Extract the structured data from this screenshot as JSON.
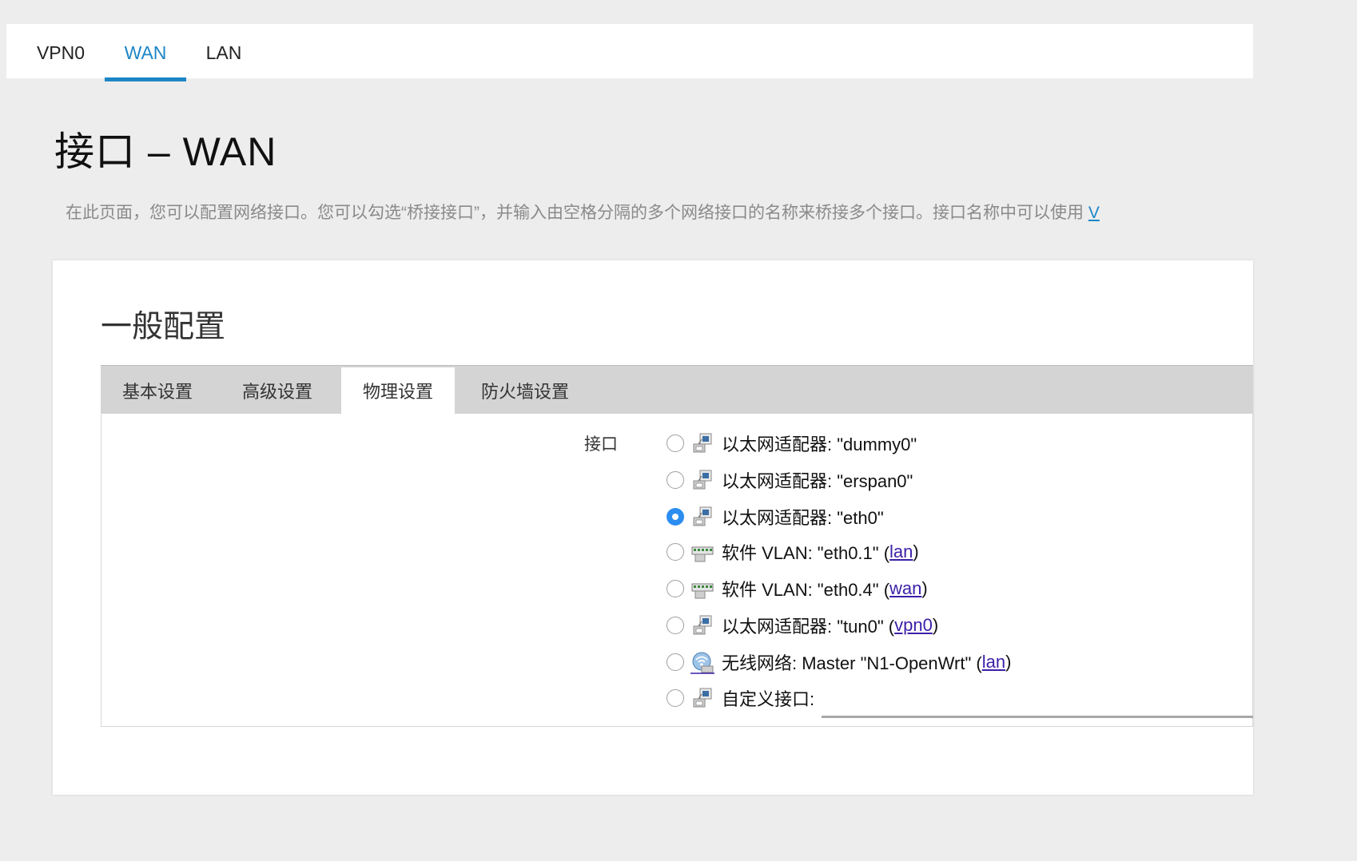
{
  "top_tabs": [
    {
      "label": "VPN0"
    },
    {
      "label": "WAN"
    },
    {
      "label": "LAN"
    }
  ],
  "page": {
    "title": "接口 – WAN",
    "description": "在此页面，您可以配置网络接口。您可以勾选“桥接接口”，并输入由空格分隔的多个网络接口的名称来桥接多个接口。接口名称中可以使用",
    "description_link": "V"
  },
  "section": {
    "title": "一般配置",
    "tabs": [
      {
        "label": "基本设置"
      },
      {
        "label": "高级设置"
      },
      {
        "label": "物理设置"
      },
      {
        "label": "防火墙设置"
      }
    ],
    "active_tab": "物理设置"
  },
  "interface_field": {
    "label": "接口",
    "options": [
      {
        "icon": "ethernet-icon",
        "text": "以太网适配器: \"dummy0\"",
        "network": "",
        "checked": false
      },
      {
        "icon": "ethernet-icon",
        "text": "以太网适配器: \"erspan0\"",
        "network": "",
        "checked": false
      },
      {
        "icon": "ethernet-icon",
        "text": "以太网适配器: \"eth0\"",
        "network": "",
        "checked": true
      },
      {
        "icon": "switch-icon",
        "text": "软件 VLAN: \"eth0.1\" (",
        "network": "lan",
        "checked": false
      },
      {
        "icon": "switch-icon",
        "text": "软件 VLAN: \"eth0.4\" (",
        "network": "wan",
        "checked": false
      },
      {
        "icon": "ethernet-icon",
        "text": "以太网适配器: \"tun0\" (",
        "network": "vpn0",
        "checked": false
      },
      {
        "icon": "wifi-icon",
        "text": "无线网络: Master \"N1-OpenWrt\" (",
        "network": "lan",
        "checked": false
      },
      {
        "icon": "ethernet-icon",
        "text": "自定义接口:",
        "network": "",
        "checked": false
      }
    ],
    "custom_value": ""
  },
  "colors": {
    "accent": "#1c86c6",
    "radio_checked": "#2b8df0",
    "link": "#3c1fa8"
  }
}
